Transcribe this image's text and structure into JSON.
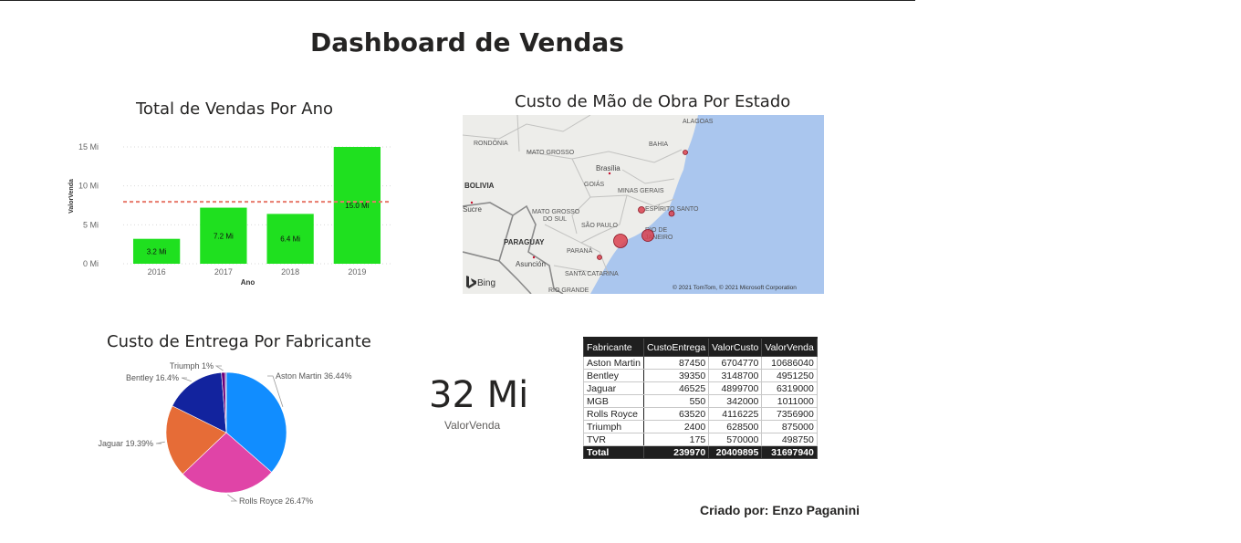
{
  "title": "Dashboard de Vendas",
  "bar_panel": {
    "title": "Total de Vendas Por Ano"
  },
  "map_panel": {
    "title": "Custo de Mão de Obra Por Estado",
    "labels": [
      "ALAGOAS",
      "RONDÔNIA",
      "BAHIA",
      "MATO GROSSO",
      "Brasília",
      "BOLIVIA",
      "GOIÁS",
      "MINAS GERAIS",
      "Sucre",
      "ESPÍRITO SANTO",
      "MATO GROSSO",
      "DO SUL",
      "SÃO PAULO",
      "RIO DE",
      "JANEIRO",
      "PARAGUAY",
      "PARANÁ",
      "Asunción",
      "SANTA CATARINA",
      "RIO GRANDE"
    ],
    "brand": "Bing",
    "copyright": "© 2021 TomTom, © 2021 Microsoft Corporation"
  },
  "pie_panel": {
    "title": "Custo de Entrega Por Fabricante"
  },
  "card": {
    "value": "32 Mi",
    "label": "ValorVenda"
  },
  "table": {
    "headers": [
      "Fabricante",
      "CustoEntrega",
      "ValorCusto",
      "ValorVenda"
    ],
    "rows": [
      [
        "Aston Martin",
        "87450",
        "6704770",
        "10686040"
      ],
      [
        "Bentley",
        "39350",
        "3148700",
        "4951250"
      ],
      [
        "Jaguar",
        "46525",
        "4899700",
        "6319000"
      ],
      [
        "MGB",
        "550",
        "342000",
        "1011000"
      ],
      [
        "Rolls Royce",
        "63520",
        "4116225",
        "7356900"
      ],
      [
        "Triumph",
        "2400",
        "628500",
        "875000"
      ],
      [
        "TVR",
        "175",
        "570000",
        "498750"
      ]
    ],
    "total": [
      "Total",
      "239970",
      "20409895",
      "31697940"
    ]
  },
  "credit": "Criado por: Enzo Paganini",
  "chart_data": [
    {
      "type": "bar",
      "title": "Total de Vendas Por Ano",
      "xlabel": "Ano",
      "ylabel": "ValorVenda",
      "categories": [
        "2016",
        "2017",
        "2018",
        "2019"
      ],
      "values": [
        3.2,
        7.2,
        6.4,
        15.0
      ],
      "data_labels": [
        "3.2 Mi",
        "7.2 Mi",
        "6.4 Mi",
        "15.0 Mi"
      ],
      "yticks": [
        "0 Mi",
        "5 Mi",
        "10 Mi",
        "15 Mi"
      ],
      "ylim": [
        0,
        15
      ],
      "average_line": 7.95,
      "color": "#1FE01F",
      "reference_color": "#E8796B",
      "grid": true
    },
    {
      "type": "pie",
      "title": "Custo de Entrega Por Fabricante",
      "slices": [
        {
          "label": "Aston Martin 36.44%",
          "value": 36.44,
          "color": "#118DFF"
        },
        {
          "label": "Rolls Royce 26.47%",
          "value": 26.47,
          "color": "#E044A7"
        },
        {
          "label": "Jaguar 19.39%",
          "value": 19.39,
          "color": "#E66C37"
        },
        {
          "label": "Bentley 16.4%",
          "value": 16.4,
          "color": "#12239E"
        },
        {
          "label": "Triumph 1%",
          "value": 1.0,
          "color": "#6B007B"
        },
        {
          "label": "",
          "value": 0.3,
          "color": "#744EC2"
        }
      ]
    }
  ]
}
